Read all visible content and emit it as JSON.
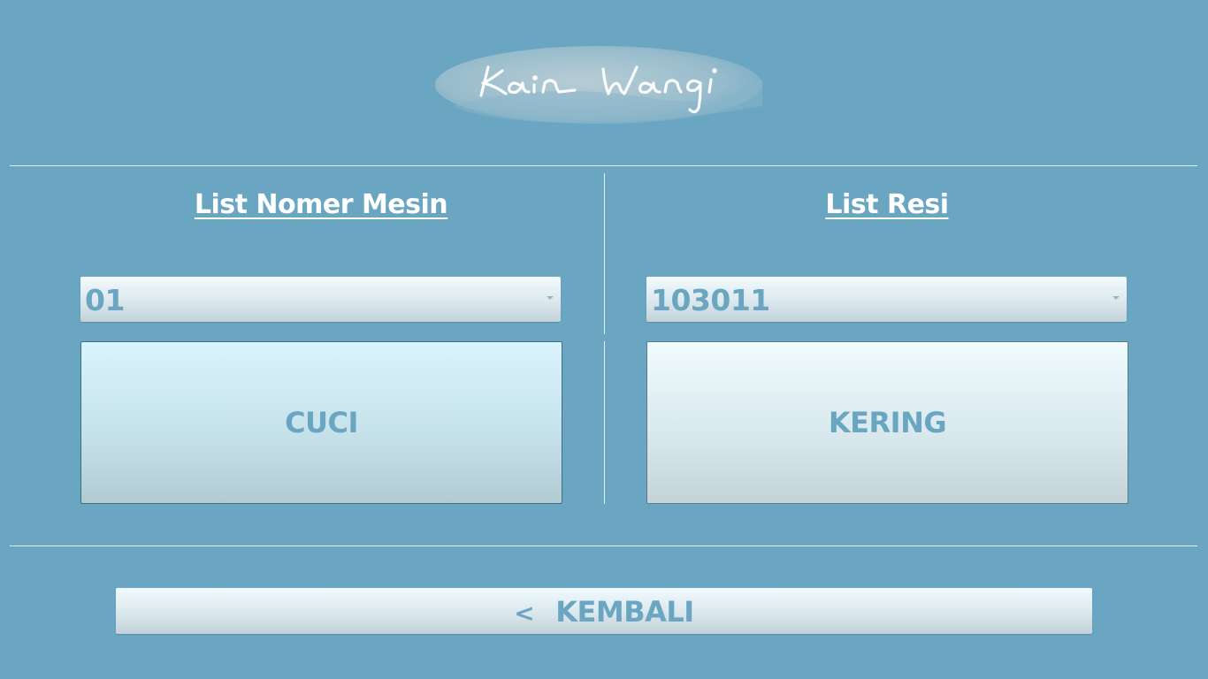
{
  "logo": {
    "text": "Kain Wangi"
  },
  "left_panel": {
    "heading": "List Nomer Mesin",
    "select_value": "01",
    "button_label": "CUCI"
  },
  "right_panel": {
    "heading": "List Resi",
    "select_value": "103011",
    "button_label": "KERING"
  },
  "footer": {
    "back_arrow": "<",
    "back_label": "KEMBALI"
  },
  "colors": {
    "background": "#6aa6c1",
    "accent_text": "#6aa6c1",
    "heading_text": "#ffffff"
  }
}
